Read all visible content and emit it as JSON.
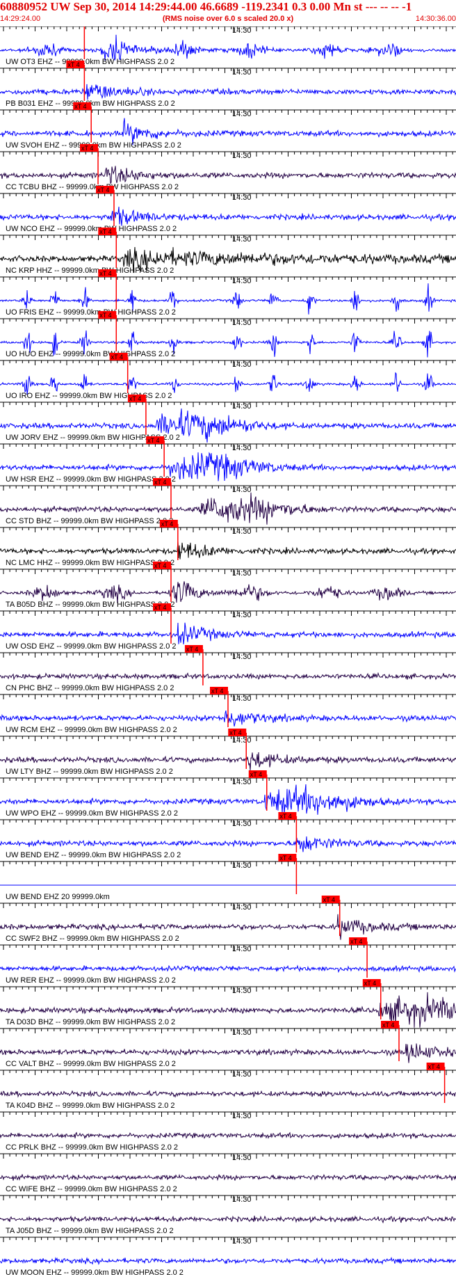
{
  "header": {
    "title": "60880952 UW Sep 30, 2014 14:29:44.00   46.6689 -119.2341  0.3 0.00 Mn st --- -- --  -1",
    "start_time": "14:29:24.00",
    "note": "(RMS noise over 6.0 s scaled 20.0 x)",
    "end_time": "14:30:36.00"
  },
  "colors": {
    "header_red": "#e00000",
    "pick_red": "#ff0000",
    "blue": "#0000ff",
    "dark_purple": "#220044",
    "black": "#000000",
    "axis": "#000000"
  },
  "chart_data": {
    "type": "line",
    "x_unit": "time",
    "x_range": [
      "14:29:24.00",
      "14:30:36.00"
    ],
    "tick_label": "14:30",
    "pick_label": "xT 4",
    "grid": false,
    "traces": [
      {
        "label": "UW OT3 EHZ -- 99999.0km BW  HIGHPASS  2.0  2",
        "color": "blue",
        "pick": 0.185,
        "style": "bursts",
        "p": 0.23
      },
      {
        "label": "PB B031 EHZ -- 99999.0km BW  HIGHPASS  2.0  2",
        "color": "blue",
        "pick": 0.185,
        "style": "normal",
        "p": 0.19
      },
      {
        "label": "UW SVOH EHZ -- 99999.0km BW  HIGHPASS  2.0  2",
        "color": "blue",
        "pick": 0.2,
        "style": "normal",
        "p": 0.27
      },
      {
        "label": "CC TCBU BHZ -- 99999.0km BW  HIGHPASS  2.0  2",
        "color": "dark_purple",
        "pick": 0.215,
        "style": "normal",
        "p": 0.23
      },
      {
        "label": "UW NCO EHZ -- 99999.0km BW  HIGHPASS  2.0  2",
        "color": "blue",
        "pick": 0.25,
        "style": "normal",
        "p": 0.24
      },
      {
        "label": "NC KRP HHZ -- 99999.0km BW  HIGHPASS  2.0  2",
        "color": "black",
        "pick": 0.255,
        "style": "strong",
        "p": 0.27
      },
      {
        "label": "UO FRIS EHZ -- 99999.0km BW  HIGHPASS  2.0  2",
        "color": "blue",
        "pick": 0.255,
        "style": "spikes",
        "p": 0.29
      },
      {
        "label": "UO HUO EHZ -- 99999.0km BW  HIGHPASS  2.0  2",
        "color": "blue",
        "pick": 0.255,
        "style": "spikes",
        "p": 0.29
      },
      {
        "label": "UO IRO EHZ -- 99999.0km BW  HIGHPASS  2.0  2",
        "color": "blue",
        "pick": 0.28,
        "style": "spikes",
        "p": 0.29
      },
      {
        "label": "UW JORV EHZ -- 99999.0km BW  HIGHPASS  2.0  2",
        "color": "blue",
        "pick": 0.32,
        "style": "emergent",
        "p": 0.34
      },
      {
        "label": "UW HSR EHZ -- 99999.0km BW  HIGHPASS  2.0  2",
        "color": "blue",
        "pick": 0.36,
        "style": "emergent",
        "p": 0.37
      },
      {
        "label": "CC STD BHZ -- 99999.0km BW  HIGHPASS  2.0  2",
        "color": "dark_purple",
        "pick": 0.375,
        "style": "emergent",
        "p": 0.44
      },
      {
        "label": "NC LMC HHZ -- 99999.0km BW  HIGHPASS  2.0  2",
        "color": "black",
        "pick": 0.39,
        "style": "normal",
        "p": 0.39
      },
      {
        "label": "TA B05D BHZ -- 99999.0km BW  HIGHPASS  2.0  2",
        "color": "dark_purple",
        "pick": 0.375,
        "style": "bursts",
        "p": 0.38
      },
      {
        "label": "UW OSD EHZ -- 99999.0km BW  HIGHPASS  2.0  2",
        "color": "blue",
        "pick": 0.375,
        "style": "normal",
        "p": 0.39
      },
      {
        "label": "CN PHC BHZ -- 99999.0km BW  HIGHPASS  2.0  2",
        "color": "dark_purple",
        "pick": 0.445,
        "style": "quiet",
        "p": 0.45
      },
      {
        "label": "UW RCM EHZ -- 99999.0km BW  HIGHPASS  2.0  2",
        "color": "blue",
        "pick": 0.5,
        "style": "normal",
        "p": 0.49
      },
      {
        "label": "UW LTY BHZ -- 99999.0km BW  HIGHPASS  2.0  2",
        "color": "dark_purple",
        "pick": 0.54,
        "style": "normal",
        "p": 0.54
      },
      {
        "label": "UW WPO EHZ -- 99999.0km BW  HIGHPASS  2.0  2",
        "color": "blue",
        "pick": 0.585,
        "style": "emergent",
        "p": 0.58
      },
      {
        "label": "UW BEND EHZ -- 99999.0km BW  HIGHPASS  2.0  2",
        "color": "blue",
        "pick": 0.65,
        "style": "normal",
        "p": 0.65
      },
      {
        "label": "UW BEND EHZ 20 99999.0km",
        "color": "blue",
        "pick": 0.65,
        "style": "flat",
        "p": 0.65
      },
      {
        "label": "CC SWF2 BHZ -- 99999.0km BW  HIGHPASS  2.0  2",
        "color": "dark_purple",
        "pick": 0.745,
        "style": "normal",
        "p": 0.74
      },
      {
        "label": "UW RER EHZ -- 99999.0km BW  HIGHPASS  2.0  2",
        "color": "blue",
        "pick": 0.805,
        "style": "quiet",
        "p": 0.82
      },
      {
        "label": "TA D03D BHZ -- 99999.0km BW  HIGHPASS  2.0  2",
        "color": "dark_purple",
        "pick": 0.835,
        "style": "emergent",
        "p": 0.83
      },
      {
        "label": "CC VALT BHZ -- 99999.0km BW  HIGHPASS  2.0  2",
        "color": "dark_purple",
        "pick": 0.875,
        "style": "normal",
        "p": 0.89
      },
      {
        "label": "TA K04D BHZ -- 99999.0km BW  HIGHPASS  2.0  2",
        "color": "dark_purple",
        "pick": 0.975,
        "style": "quiet",
        "p": 0.98
      },
      {
        "label": "CC PRLK BHZ -- 99999.0km BW  HIGHPASS  2.0  2",
        "color": "dark_purple",
        "pick": null,
        "style": "quiet",
        "p": 0.0
      },
      {
        "label": "CC WIFE BHZ -- 99999.0km BW  HIGHPASS  2.0  2",
        "color": "dark_purple",
        "pick": null,
        "style": "quiet",
        "p": 0.0
      },
      {
        "label": "TA J05D BHZ -- 99999.0km BW  HIGHPASS  2.0  2",
        "color": "dark_purple",
        "pick": null,
        "style": "quiet",
        "p": 0.0
      },
      {
        "label": "UW MOON EHZ -- 99999.0km BW  HIGHPASS  2.0  2",
        "color": "blue",
        "pick": null,
        "style": "quiet",
        "p": 0.0
      }
    ]
  }
}
